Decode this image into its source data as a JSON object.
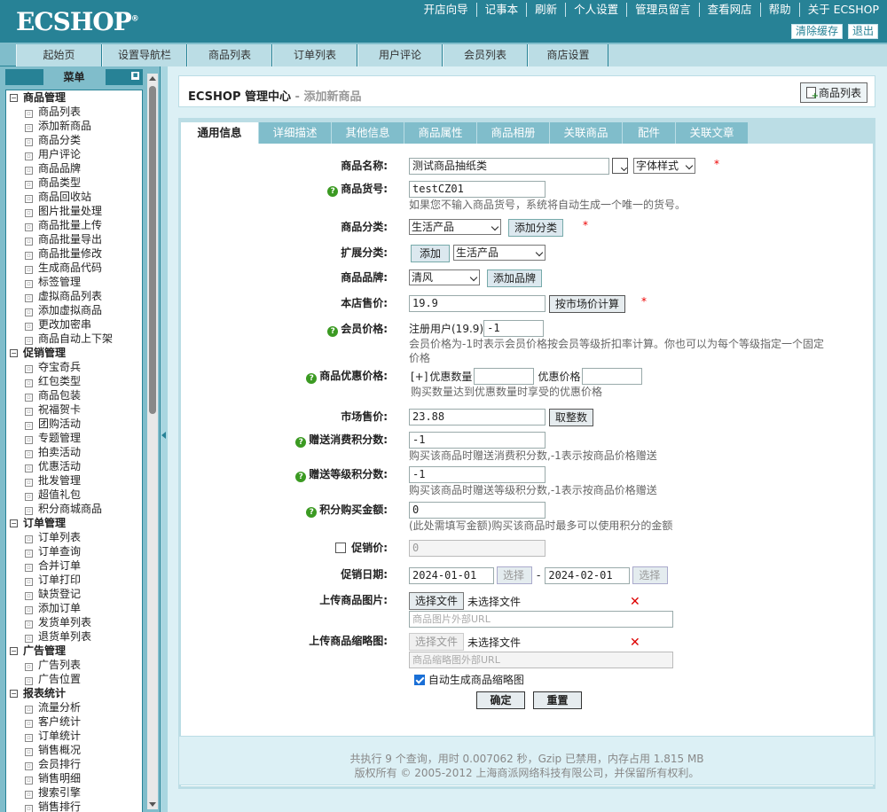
{
  "header": {
    "logo": "ECSHOP",
    "logo_mark": "®",
    "nav": [
      "开店向导",
      "记事本",
      "刷新",
      "个人设置",
      "管理员留言",
      "查看网店",
      "帮助",
      "关于 ECSHOP"
    ],
    "clear_cache": "清除缓存",
    "logout": "退出"
  },
  "main_tabs": [
    "起始页",
    "设置导航栏",
    "商品列表",
    "订单列表",
    "用户评论",
    "会员列表",
    "商店设置"
  ],
  "sidebar": {
    "title": "菜单",
    "collapse_glyph": "▪",
    "groups": [
      {
        "label": "商品管理",
        "items": [
          "商品列表",
          "添加新商品",
          "商品分类",
          "用户评论",
          "商品品牌",
          "商品类型",
          "商品回收站",
          "图片批量处理",
          "商品批量上传",
          "商品批量导出",
          "商品批量修改",
          "生成商品代码",
          "标签管理",
          "虚拟商品列表",
          "添加虚拟商品",
          "更改加密串",
          "商品自动上下架"
        ]
      },
      {
        "label": "促销管理",
        "items": [
          "夺宝奇兵",
          "红包类型",
          "商品包装",
          "祝福贺卡",
          "团购活动",
          "专题管理",
          "拍卖活动",
          "优惠活动",
          "批发管理",
          "超值礼包",
          "积分商城商品"
        ]
      },
      {
        "label": "订单管理",
        "items": [
          "订单列表",
          "订单查询",
          "合并订单",
          "订单打印",
          "缺货登记",
          "添加订单",
          "发货单列表",
          "退货单列表"
        ]
      },
      {
        "label": "广告管理",
        "items": [
          "广告列表",
          "广告位置"
        ]
      },
      {
        "label": "报表统计",
        "items": [
          "流量分析",
          "客户统计",
          "订单统计",
          "销售概况",
          "会员排行",
          "销售明细",
          "搜索引擎",
          "销售排行"
        ]
      }
    ]
  },
  "page": {
    "title": "ECSHOP 管理中心",
    "subtitle": " - 添加新商品",
    "list_button": "商品列表"
  },
  "form_tabs": [
    "通用信息",
    "详细描述",
    "其他信息",
    "商品属性",
    "商品相册",
    "关联商品",
    "配件",
    "关联文章"
  ],
  "form": {
    "name_label": "商品名称:",
    "name_value": "测试商品抽纸类",
    "font_style": "字体样式",
    "sn_label": "商品货号:",
    "sn_value": "testCZ01",
    "sn_note": "如果您不输入商品货号，系统将自动生成一个唯一的货号。",
    "cat_label": "商品分类:",
    "cat_value": "生活产品",
    "add_cat": "添加分类",
    "ext_cat_label": "扩展分类:",
    "add": "添加",
    "ext_cat_value": "生活产品",
    "brand_label": "商品品牌:",
    "brand_value": "清风",
    "add_brand": "添加品牌",
    "price_label": "本店售价:",
    "price_value": "19.9",
    "market_calc": "按市场价计算",
    "member_label": "会员价格:",
    "member_user": "注册用户(19.9)",
    "member_value": "-1",
    "member_note": "会员价格为-1时表示会员价格按会员等级折扣率计算。你也可以为每个等级指定一个固定价格",
    "volume_label": "商品优惠价格:",
    "volume_add": "[+]",
    "volume_qty": "优惠数量",
    "volume_price": "优惠价格",
    "volume_note": "购买数量达到优惠数量时享受的优惠价格",
    "market_label": "市场售价:",
    "market_value": "23.88",
    "round": "取整数",
    "give_label": "赠送消费积分数:",
    "give_value": "-1",
    "give_note": "购买该商品时赠送消费积分数,-1表示按商品价格赠送",
    "rank_label": "赠送等级积分数:",
    "rank_value": "-1",
    "rank_note": "购买该商品时赠送等级积分数,-1表示按商品价格赠送",
    "integral_label": "积分购买金额:",
    "integral_value": "0",
    "integral_note": "(此处需填写金额)购买该商品时最多可以使用积分的金额",
    "promote_label": "促销价:",
    "promote_value": "0",
    "promote_date_label": "促销日期:",
    "start_date": "2024-01-01",
    "select": "选择",
    "dash": "-",
    "end_date": "2024-02-01",
    "upload_img_label": "上传商品图片:",
    "choose_file": "选择文件",
    "no_file": "未选择文件",
    "img_url_placeholder": "商品图片外部URL",
    "upload_thumb_label": "上传商品缩略图:",
    "thumb_url_placeholder": "商品缩略图外部URL",
    "auto_thumb": "自动生成商品缩略图",
    "ok": "确定",
    "reset": "重置",
    "required": "*",
    "remove": "✕"
  },
  "footer": {
    "line1": "共执行 9 个查询，用时 0.007062 秒，Gzip 已禁用，内存占用 1.815 MB",
    "line2": "版权所有 © 2005-2012 上海商派网络科技有限公司，并保留所有权利。"
  }
}
